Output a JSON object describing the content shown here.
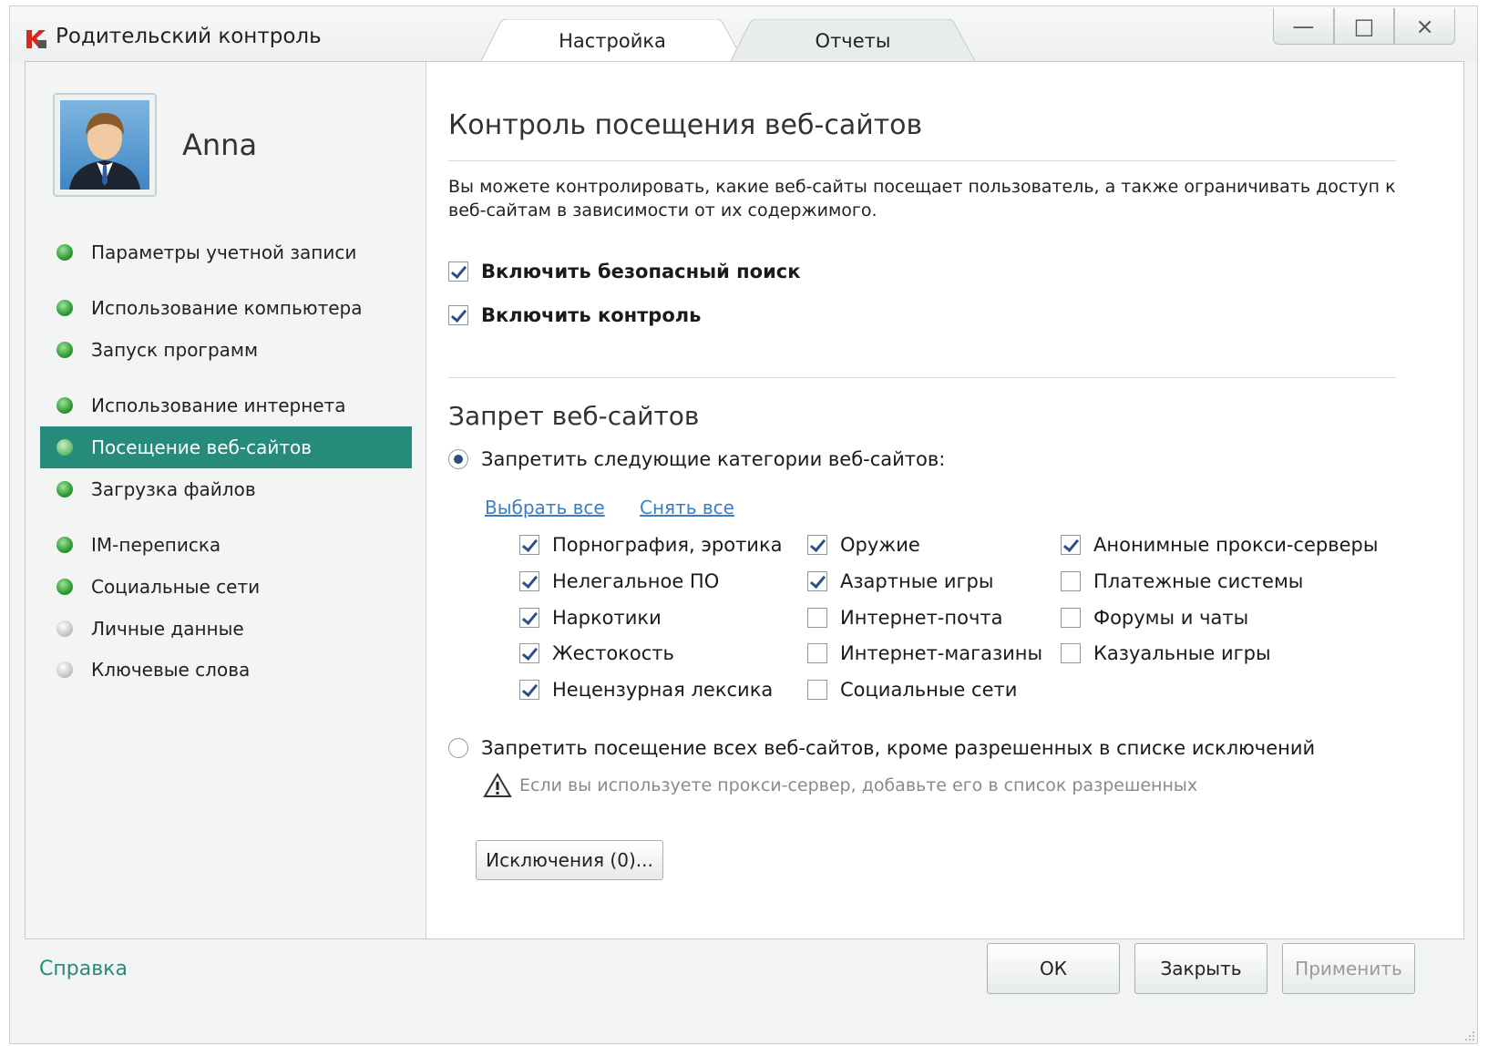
{
  "app": {
    "title": "Родительский контроль",
    "tabs": [
      {
        "label": "Настройка",
        "active": true
      },
      {
        "label": "Отчеты",
        "active": false
      }
    ],
    "window_buttons": {
      "minimize": "—",
      "maximize": "□",
      "close": "×"
    }
  },
  "sidebar": {
    "user_name": "Anna",
    "items": [
      {
        "label": "Параметры учетной записи",
        "status": "green"
      },
      {
        "label": "Использование компьютера",
        "status": "green"
      },
      {
        "label": "Запуск программ",
        "status": "green"
      },
      {
        "label": "Использование интернета",
        "status": "green"
      },
      {
        "label": "Посещение веб-сайтов",
        "status": "green",
        "active": true
      },
      {
        "label": "Загрузка файлов",
        "status": "green"
      },
      {
        "label": "IM-переписка",
        "status": "green"
      },
      {
        "label": "Социальные сети",
        "status": "green"
      },
      {
        "label": "Личные данные",
        "status": "grey"
      },
      {
        "label": "Ключевые слова",
        "status": "grey"
      }
    ]
  },
  "main": {
    "title": "Контроль посещения веб-сайтов",
    "description": "Вы можете контролировать, какие веб-сайты посещает пользователь, а также ограничивать доступ к веб-сайтам в зависимости от их содержимого.",
    "safe_search": {
      "label": "Включить безопасный поиск",
      "checked": true
    },
    "enable_control": {
      "label": "Включить контроль",
      "checked": true
    },
    "block_section_title": "Запрет веб-сайтов",
    "radio_block_categories": {
      "label": "Запретить следующие категории веб-сайтов:",
      "selected": true
    },
    "select_all_link": "Выбрать все",
    "clear_all_link": "Снять все",
    "categories": [
      [
        {
          "label": "Порнография, эротика",
          "checked": true
        },
        {
          "label": "Нелегальное ПО",
          "checked": true
        },
        {
          "label": "Наркотики",
          "checked": true
        },
        {
          "label": "Жестокость",
          "checked": true
        },
        {
          "label": "Нецензурная лексика",
          "checked": true
        }
      ],
      [
        {
          "label": "Оружие",
          "checked": true
        },
        {
          "label": "Азартные игры",
          "checked": true
        },
        {
          "label": "Интернет-почта",
          "checked": false
        },
        {
          "label": "Интернет-магазины",
          "checked": false
        },
        {
          "label": "Социальные сети",
          "checked": false
        }
      ],
      [
        {
          "label": "Анонимные прокси-серверы",
          "checked": true
        },
        {
          "label": "Платежные системы",
          "checked": false
        },
        {
          "label": "Форумы и чаты",
          "checked": false
        },
        {
          "label": "Казуальные игры",
          "checked": false
        }
      ]
    ],
    "radio_block_all": {
      "label": "Запретить посещение всех веб-сайтов, кроме разрешенных в списке исключений",
      "selected": false
    },
    "proxy_warning": "Если вы используете прокси-сервер, добавьте его в список разрешенных",
    "exceptions_button": "Исключения (0)..."
  },
  "footer": {
    "help_link": "Справка",
    "ok_button": "ОК",
    "close_button": "Закрыть",
    "apply_button": "Применить",
    "apply_disabled": true
  },
  "colors": {
    "accent": "#268b7a",
    "link": "#3a7fc4",
    "help": "#2a8a7a"
  }
}
